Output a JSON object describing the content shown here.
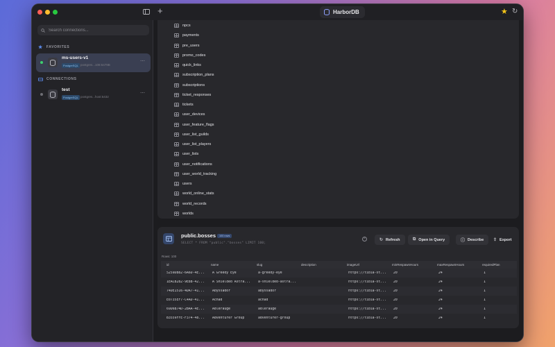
{
  "app": {
    "title": "HarborDB"
  },
  "sidebar": {
    "search_placeholder": "Search connections...",
    "favorites_label": "FAVORITES",
    "connections_label": "CONNECTIONS",
    "favorites": [
      {
        "name": "ms-users-v1",
        "badge": "PostgreSQL",
        "host": "postgres...108:6479B",
        "status": "connected",
        "status_color": "#3ecf6e"
      }
    ],
    "connections": [
      {
        "name": "test",
        "badge": "PostgreSQL",
        "host": "postgres...host:5432",
        "status": "disconnected",
        "status_color": "#6e6e74"
      }
    ]
  },
  "tables": [
    "npcs",
    "payments",
    "pre_users",
    "promo_codes",
    "quick_links",
    "subscription_plans",
    "subscriptions",
    "ticket_responses",
    "tickets",
    "user_devices",
    "user_feature_flags",
    "user_list_guilds",
    "user_list_players",
    "user_lists",
    "user_notifications",
    "user_world_tracking",
    "users",
    "world_online_stats",
    "world_records",
    "worlds"
  ],
  "query": {
    "table": "public.bosses",
    "badge": "100 rows",
    "sql": "SELECT * FROM \"public\".\"bosses\" LIMIT 100;",
    "rows_meta": "Rows: 100",
    "buttons": {
      "refresh": "Refresh",
      "open": "Open in Query",
      "describe": "Describe",
      "export": "Export"
    },
    "columns": [
      "id",
      "name",
      "slug",
      "description",
      "imageUrl",
      "minRespawnHours",
      "maxRespawnHours",
      "requiredPlan"
    ],
    "rows": [
      [
        "5259DB82-6A6D-4E...",
        "A Greedy Eye",
        "a-greedy-eye",
        "",
        "https://tibia-st...",
        "20",
        "24",
        "1"
      ],
      [
        "1EACB282-9E8B-42...",
        "A Shielded Astra...",
        "a-shielded-astra...",
        "",
        "https://tibia-st...",
        "20",
        "24",
        "1"
      ],
      [
        "74DE1516-4DA7-41...",
        "Abyssador",
        "abyssador",
        "",
        "https://tibia-st...",
        "20",
        "24",
        "1"
      ],
      [
        "E0735EF7-C4AD-41...",
        "Achad",
        "achad",
        "",
        "https://tibia-st...",
        "20",
        "24",
        "1"
      ],
      [
        "69D6B74D-2BAA-4E...",
        "Adlerauge",
        "adlerauge",
        "",
        "https://tibia-st...",
        "20",
        "24",
        "1"
      ],
      [
        "B3559FFE-F374-48...",
        "Adventurer Group",
        "adventurer-group",
        "",
        "https://tibia-st...",
        "20",
        "24",
        "1"
      ]
    ]
  }
}
